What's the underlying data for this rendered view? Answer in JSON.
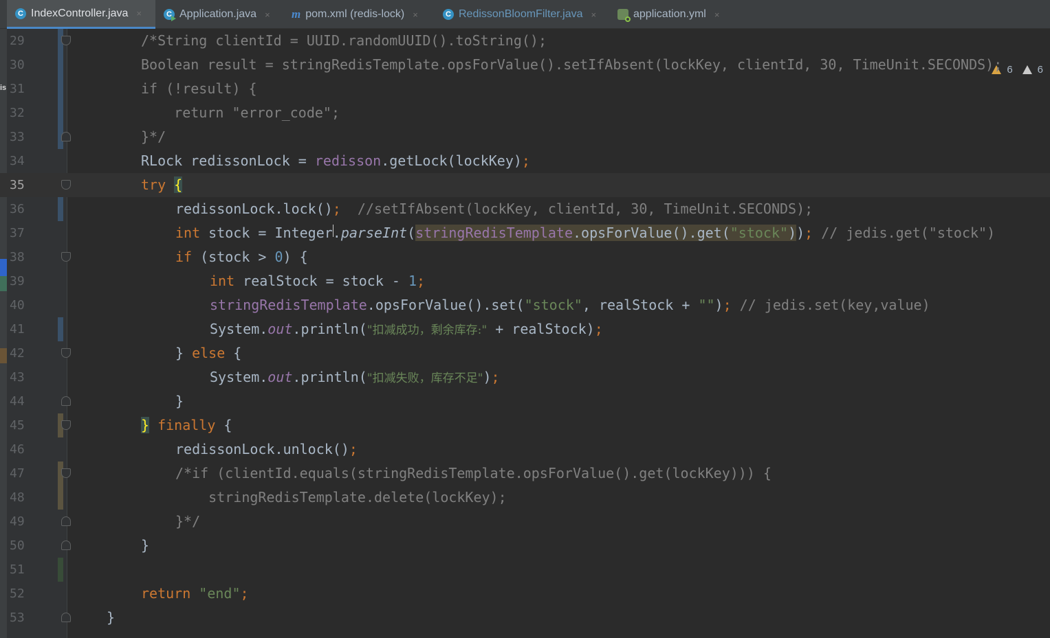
{
  "tabs": [
    {
      "label": "IndexController.java",
      "icon": "class-icon",
      "active": true
    },
    {
      "label": "Application.java",
      "icon": "runnable-class-icon",
      "active": false
    },
    {
      "label": "pom.xml (redis-lock)",
      "icon": "maven-icon",
      "active": false
    },
    {
      "label": "RedissonBloomFilter.java",
      "icon": "class-icon",
      "active": false,
      "modified": true
    },
    {
      "label": "application.yml",
      "icon": "spring-config-icon",
      "active": false
    }
  ],
  "close_glyph": "×",
  "inspections": {
    "warnings": "6",
    "weak_warnings": "6"
  },
  "left_strip_label": "is",
  "lines": [
    {
      "n": "29"
    },
    {
      "n": "30"
    },
    {
      "n": "31"
    },
    {
      "n": "32"
    },
    {
      "n": "33"
    },
    {
      "n": "34"
    },
    {
      "n": "35"
    },
    {
      "n": "36"
    },
    {
      "n": "37"
    },
    {
      "n": "38"
    },
    {
      "n": "39"
    },
    {
      "n": "40"
    },
    {
      "n": "41"
    },
    {
      "n": "42"
    },
    {
      "n": "43"
    },
    {
      "n": "44"
    },
    {
      "n": "45"
    },
    {
      "n": "46"
    },
    {
      "n": "47"
    },
    {
      "n": "48"
    },
    {
      "n": "49"
    },
    {
      "n": "50"
    },
    {
      "n": "51"
    },
    {
      "n": "52"
    },
    {
      "n": "53"
    }
  ],
  "code": {
    "l29": "/*String clientId = UUID.randomUUID().toString();",
    "l30": "Boolean result = stringRedisTemplate.opsForValue().setIfAbsent(lockKey, clientId, 30, TimeUnit.SECONDS);",
    "l31": "if (!result) {",
    "l32": "    return \"error_code\";",
    "l33": "}*/",
    "l34_a": "RLock redissonLock = ",
    "l34_f": "redisson",
    "l34_b": ".getLock(lockKey)",
    "semi": ";",
    "try": "try",
    "open_brace": "{",
    "l36_a": "redissonLock.lock()",
    "l36_c": "//setIfAbsent(lockKey, clientId, 30, TimeUnit.SECONDS);",
    "int": "int",
    "l37_a": " stock = Integer.",
    "parseInt": "parseInt",
    "paren_open": "(",
    "srt": "stringRedisTemplate",
    "l37_b": ".opsForValue().get(",
    "stock_str": "\"stock\"",
    "l37_d": ")",
    "l37_e": ")",
    "l37_c": "// jedis.get(\"stock\")",
    "if": "if",
    "l38_a": " (stock > ",
    "zero": "0",
    "l38_b": ") {",
    "l39_a": " realStock = stock - ",
    "one": "1",
    "l40_a": ".opsForValue().set(",
    "l40_b": ", realStock + ",
    "empty_str": "\"\"",
    "l40_c": ")",
    "l40_d": "// jedis.set(key,value)",
    "sys": "System.",
    "out": "out",
    "println": ".println(",
    "msg_ok": "\"扣减成功，剩余库存:\"",
    "l41_b": " + realStock)",
    "close_else_a": "} ",
    "else": "else",
    "l42_b": " {",
    "msg_fail": "\"扣减失败，库存不足\"",
    "l43_b": ")",
    "close_brace": "}",
    "finally": "finally",
    "l45_b": " {",
    "l46": "redissonLock.unlock()",
    "l47": "/*if (clientId.equals(stringRedisTemplate.opsForValue().get(lockKey))) {",
    "l48": "    stringRedisTemplate.delete(lockKey);",
    "l49": "}*/",
    "return": "return",
    "end_str": "\"end\""
  }
}
